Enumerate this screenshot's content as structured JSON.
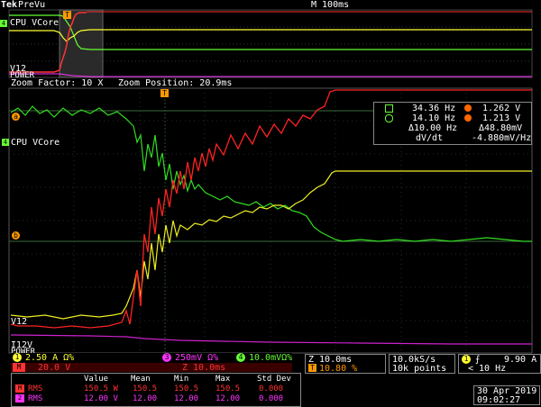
{
  "header": {
    "brand": "Tek",
    "mode": "PreVu",
    "timebase": "M 100ms"
  },
  "zoom": {
    "factor_label": "Zoom Factor: 10 X",
    "position_label": "Zoom Position: 20.9ms"
  },
  "channel_labels": {
    "cpu_vcore_top": "CPU VCore",
    "v12_top": "V12",
    "power_top": "POWER",
    "cpu_vcore_zoom": "CPU VCore",
    "v12_zoom": "V12",
    "i12v_zoom": "I12V",
    "power_zoom": "POWER"
  },
  "markers": {
    "trigger": "T",
    "ref_a": "a",
    "ref_b": "b",
    "ch1": "1",
    "ch2": "2",
    "ch3": "3",
    "ch4": "4",
    "math_m": "M"
  },
  "cursor_readout": {
    "row1_left": "34.36 Hz",
    "row1_right": "1.262 V",
    "row2_left": "14.10 Hz",
    "row2_right": "1.213 V",
    "row3_left": "Δ10.00 Hz",
    "row3_right": "Δ48.80mV",
    "row4_left": "dV/dt",
    "row4_right": "-4.880mV/Hz"
  },
  "channels_status": {
    "ch1": "2.50 A  Ω%",
    "ch3": "250mV Ω%",
    "ch4": "10.0mVΩ%",
    "math": "20.0 V",
    "math_zoom": "Z 10.0ms"
  },
  "horizontal": {
    "zoom_time": "Z 10.0ms",
    "trigger_pos": "10.80 %",
    "sample_rate": "10.0kS/s",
    "record_length": "10k points",
    "trigger_source": "1",
    "trigger_slope": "⨍",
    "trigger_level": "9.90 A",
    "trigger_freq": "< 10 Hz"
  },
  "measurements": {
    "headers": [
      "Value",
      "Mean",
      "Min",
      "Max",
      "Std Dev"
    ],
    "rows": [
      {
        "label": "RMS",
        "values": [
          "150.5 W",
          "150.5",
          "150.5",
          "150.5",
          "0.000"
        ]
      },
      {
        "label": "RMS",
        "values": [
          "12.00 V",
          "12.00",
          "12.00",
          "12.00",
          "0.000"
        ]
      }
    ]
  },
  "datetime": {
    "date": "30 Apr 2019",
    "time": "09:02:27"
  },
  "colors": {
    "ch1": "#ffff33",
    "ch2": "#33ccff",
    "ch3": "#ff33ff",
    "ch4": "#66ff33",
    "math": "#ff3333",
    "grid": "#404040"
  }
}
